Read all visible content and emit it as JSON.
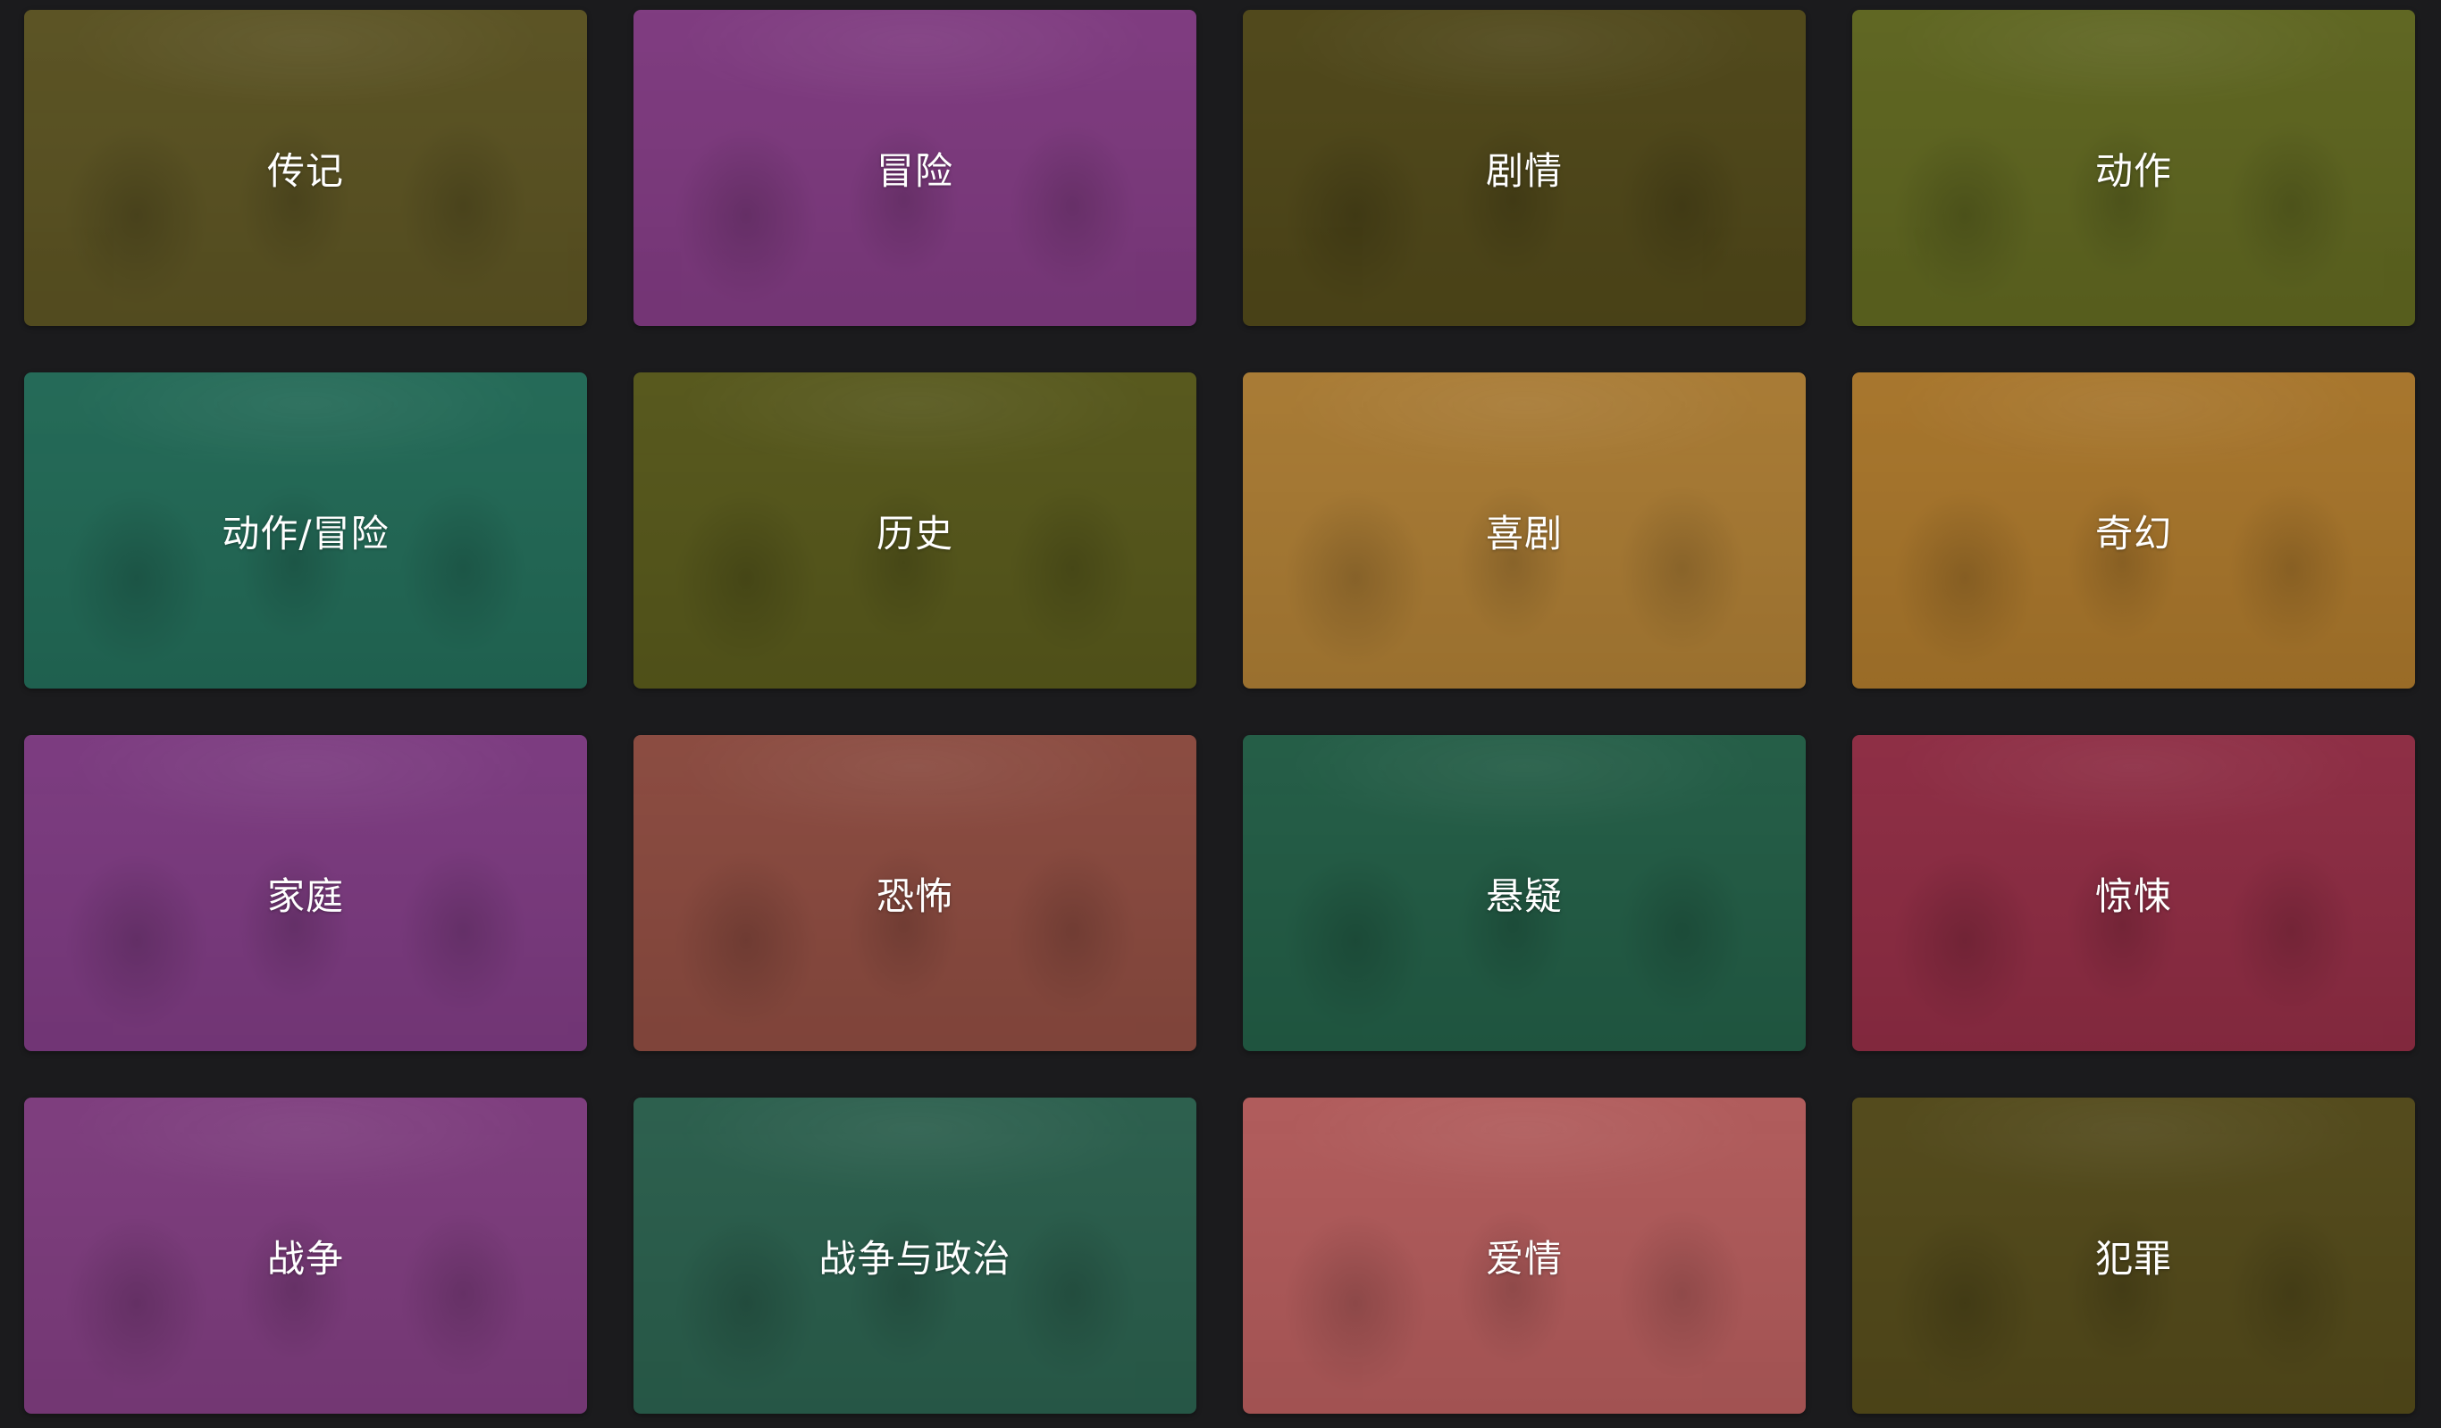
{
  "categories": [
    {
      "label": "传记",
      "color": "#5a5222"
    },
    {
      "label": "冒险",
      "color": "#7e3a7f"
    },
    {
      "label": "剧情",
      "color": "#4f4719"
    },
    {
      "label": "动作",
      "color": "#5e6520"
    },
    {
      "label": "动作/冒险",
      "color": "#226956"
    },
    {
      "label": "历史",
      "color": "#56571b"
    },
    {
      "label": "喜剧",
      "color": "#a87a33"
    },
    {
      "label": "奇幻",
      "color": "#a7752b"
    },
    {
      "label": "家庭",
      "color": "#7b3a7f"
    },
    {
      "label": "恐怖",
      "color": "#8a4a3f"
    },
    {
      "label": "悬疑",
      "color": "#225c45"
    },
    {
      "label": "惊悚",
      "color": "#8d2c43"
    },
    {
      "label": "战争",
      "color": "#7d3c7d"
    },
    {
      "label": "战争与政治",
      "color": "#2a5e4c"
    },
    {
      "label": "爱情",
      "color": "#b05a5a"
    },
    {
      "label": "犯罪",
      "color": "#52491a"
    }
  ]
}
